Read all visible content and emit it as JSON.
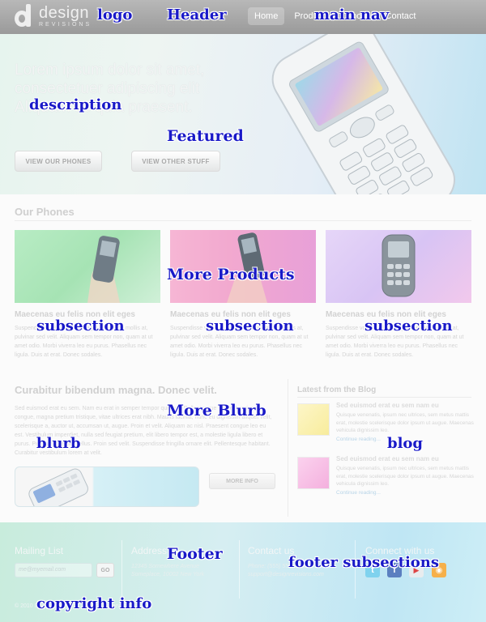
{
  "header": {
    "logo_word": "design",
    "logo_sub": "REVISIONS",
    "nav": [
      {
        "label": "Home",
        "active": true
      },
      {
        "label": "Products"
      },
      {
        "label": "About"
      },
      {
        "label": "Contact"
      }
    ]
  },
  "featured": {
    "text": "Lorem ipsum dolor sit amet, consectetuer adipiscing elit Aliquam ac quia praesent.",
    "btn_phones": "VIEW OUR PHONES",
    "btn_other": "VIEW OTHER STUFF"
  },
  "products": {
    "title": "Our Phones",
    "cards": [
      {
        "title": "Maecenas eu felis non elit eges",
        "text": "Suspendisse volutpat, lacus eget commodo mollis at, pulvinar sed velit. Aliquam sem tempor non, quam at ut amet odio. Morbi viverra leo eu purus. Phasellus nec ligula. Duis at erat. Donec sodales.",
        "image": "phone-in-hand",
        "color": "#a6e3b4"
      },
      {
        "title": "Maecenas eu felis non elit eges",
        "text": "Suspendisse volutpat, lacus eget commodo mollis at, pulvinar sed velit. Aliquam sem tempor non, quam at ut amet odio. Morbi viverra leo eu purus. Phasellus nec ligula. Duis at erat. Donec sodales.",
        "image": "phone-in-hand",
        "color": "#f2a9cf"
      },
      {
        "title": "Maecenas eu felis non elit eges",
        "text": "Suspendisse volutpat, lacus eget commodo mollis at, pulvinar sed velit. Aliquam sem tempor non, quam at ut amet odio. Morbi viverra leo eu purus. Phasellus nec ligula. Duis at erat. Donec sodales.",
        "image": "phone",
        "color": "#d8c4f4"
      }
    ]
  },
  "blurb": {
    "title": "Curabitur bibendum magna. Donec velit.",
    "text": "Sed euismod erat eu sem. Nam eu erat in semper tempor quisque. Pellentesque vel velit varius, congue, magna pretium tristique, vitae ultrices erat nibh. Mauris lacinia, nunc eu dignissim aliquet velit, scelerisque a, auctor ut, accumsan ut, augue. Proin et velit. Aliquam ac nisl. Praesent congue leo eu est. Vestibulum imperdiet, nulla sed feugiat pretium, elit libero tempor est, a molestie ligula libero et purus. Pellentesque nec tellus. Proin sed velit. Suspendisse fringilla ornare elit. Pellentesque habitant. Curabitur vestibulum lorem at velit.",
    "more_info": "MORE INFO"
  },
  "blog": {
    "title": "Latest from the Blog",
    "posts": [
      {
        "title": "Sed euismod erat eu sem nam eu",
        "text": "Quisque venenatis, ipsum nec ultrices, sem metus mattis erat, molestie scelerisque dolor ipsum ut augue. Maecenas vehicula dignissim leo.",
        "link": "Continue reading...",
        "color": "#fbf3b8"
      },
      {
        "title": "Sed euismod erat eu sem nam eu",
        "text": "Quisque venenatis, ipsum nec ultrices, sem metus mattis erat, molestie scelerisque dolor ipsum ut augue. Maecenas vehicula dignissim leo.",
        "link": "Continue reading...",
        "color": "#f7c6e6"
      }
    ]
  },
  "footer": {
    "mailing_title": "Mailing List",
    "email_placeholder": "me@myemail.com",
    "go": "GO",
    "address_title": "Address",
    "address_lines": [
      "12345 Somewhere Avenue",
      "Someplace, 10002 New York"
    ],
    "contact_title": "Contact us",
    "contact_lines": [
      "Phone: (555) 555-5555",
      "support@designrevisions.com"
    ],
    "connect_title": "Connect with us",
    "social": [
      {
        "name": "twitter-icon",
        "color": "#7fd2ee",
        "glyph": "t"
      },
      {
        "name": "facebook-icon",
        "color": "#5b7fc0",
        "glyph": "f"
      },
      {
        "name": "youtube-icon",
        "color": "#e0e4e6",
        "glyph": "▶"
      },
      {
        "name": "rss-icon",
        "color": "#f6b04a",
        "glyph": "◉"
      }
    ],
    "copyright": "© 2010 Design Revisions. All rights reserved."
  },
  "annotations": {
    "logo": "logo",
    "header": "Header",
    "main_nav": "main nav",
    "description": "description",
    "featured": "Featured",
    "more_products": "More Products",
    "subsection": "subsection",
    "more_blurb": "More Blurb",
    "blurb": "blurb",
    "blog": "blog",
    "footer": "Footer",
    "footer_subsections": "footer subsections",
    "copyright_info": "copyright info"
  }
}
